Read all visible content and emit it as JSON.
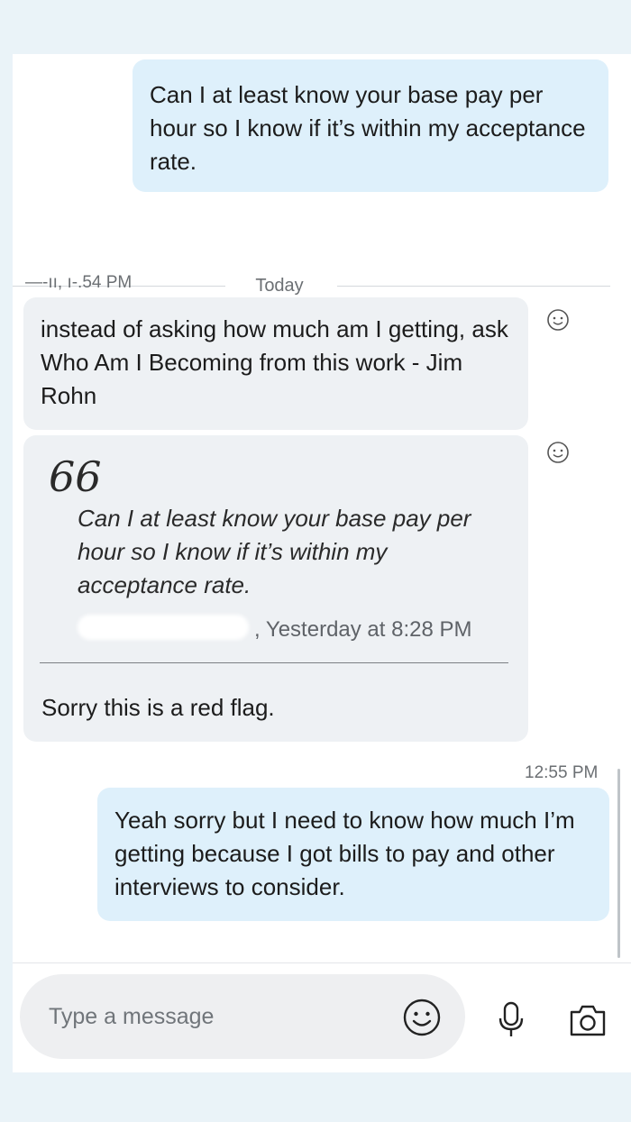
{
  "messages": [
    {
      "direction": "outgoing",
      "text": "Can I at least know your base pay per hour so I know if it’s within my acceptance rate."
    },
    {
      "direction": "incoming",
      "text": "instead of asking how much am I getting, ask Who Am I Becoming from this work - Jim Rohn"
    },
    {
      "direction": "incoming",
      "quote": {
        "text": "Can I at least know your base pay per hour so I know if it’s within my acceptance rate.",
        "meta": ", Yesterday at 8:28 PM"
      },
      "text": "Sorry this is a red flag."
    },
    {
      "direction": "outgoing",
      "text": "Yeah sorry but I need to know how much I’m getting because I got bills to pay and other interviews to consider."
    }
  ],
  "divider": {
    "label": "Today"
  },
  "timestamps": {
    "incoming_group": "—-ıı, ı-.54 PM",
    "outgoing_group": "12:55 PM"
  },
  "composer": {
    "placeholder": "Type a message"
  },
  "icons": {
    "reaction": "smiley-react-icon",
    "emoji": "emoji-icon",
    "mic": "microphone-icon",
    "camera": "camera-icon"
  },
  "colors": {
    "outgoing_bubble": "#def0fb",
    "incoming_bubble": "#eef1f4",
    "background": "#eaf3f8"
  }
}
